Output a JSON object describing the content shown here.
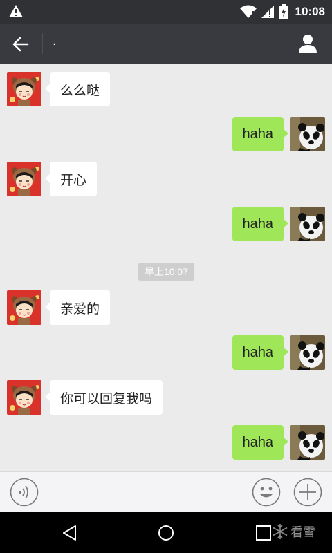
{
  "status_bar": {
    "time": "10:08",
    "icons": [
      "warning-icon",
      "wifi-icon",
      "signal-icon",
      "battery-charging-icon"
    ]
  },
  "header": {
    "title": ".",
    "icons": [
      "back-arrow-icon",
      "profile-icon"
    ]
  },
  "messages": [
    {
      "side": "left",
      "text": "么么哒",
      "avatar": "cartoon-girl-avatar"
    },
    {
      "side": "right",
      "text": "haha",
      "avatar": "panda-avatar"
    },
    {
      "side": "left",
      "text": "开心",
      "avatar": "cartoon-girl-avatar"
    },
    {
      "side": "right",
      "text": "haha",
      "avatar": "panda-avatar"
    },
    {
      "side": "left",
      "text": "亲爱的",
      "avatar": "cartoon-girl-avatar"
    },
    {
      "side": "right",
      "text": "haha",
      "avatar": "panda-avatar"
    },
    {
      "side": "left",
      "text": "你可以回复我吗",
      "avatar": "cartoon-girl-avatar"
    },
    {
      "side": "right",
      "text": "haha",
      "avatar": "panda-avatar"
    }
  ],
  "timestamp": "早上10:07",
  "input_bar": {
    "icons": [
      "voice-icon",
      "emoji-icon",
      "plus-icon"
    ],
    "value": ""
  },
  "nav_bar": {
    "icons": [
      "nav-back-icon",
      "nav-home-icon",
      "nav-recents-icon"
    ]
  },
  "watermark": {
    "text": "看雪",
    "icon": "snowflake-icon"
  },
  "colors": {
    "status_bar": "#2f3135",
    "app_bar": "#393a3f",
    "chat_background": "#ebebeb",
    "sent_bubble": "#9fe658",
    "received_bubble": "#ffffff",
    "timestamp_pill": "#cecece"
  }
}
